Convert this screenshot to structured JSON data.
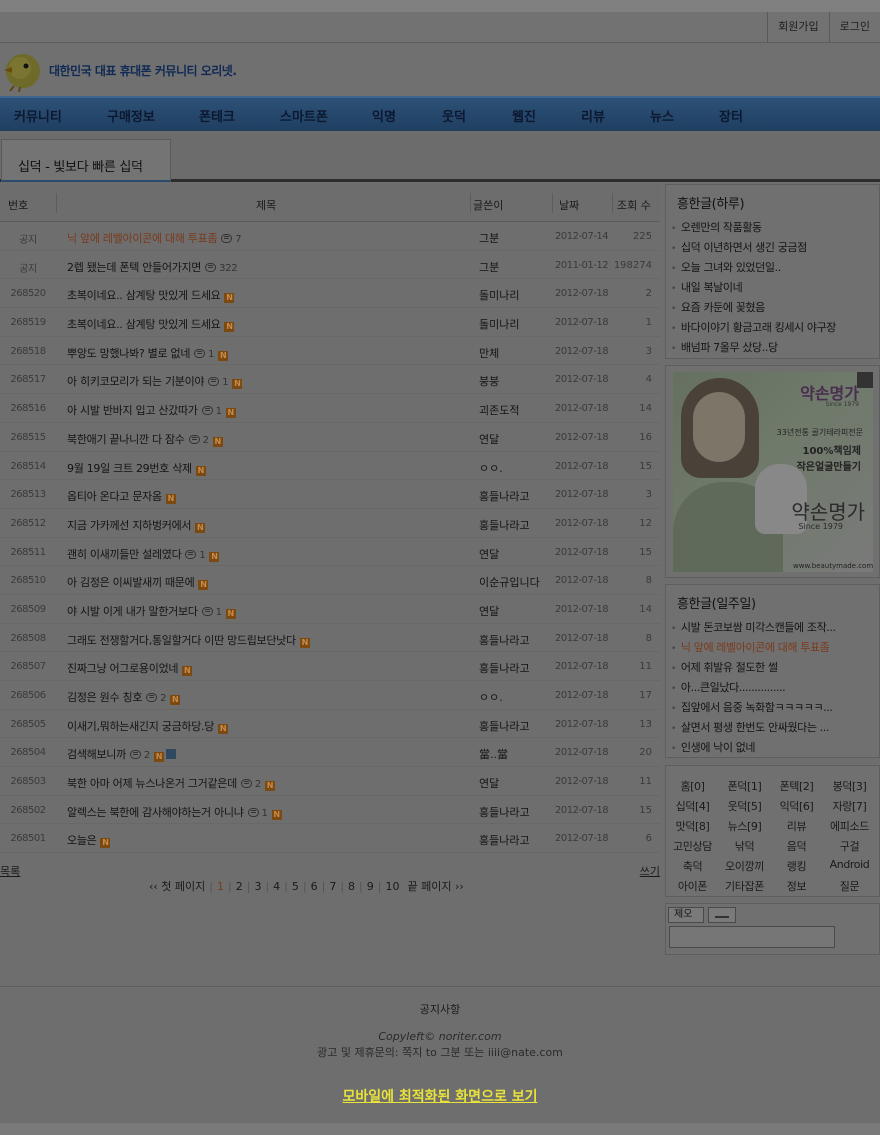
{
  "top_links": [
    "회원가입",
    "로그인"
  ],
  "header": {
    "slogan": "대한민국 대표 휴대폰 커뮤니티 오리넷."
  },
  "nav": [
    "커뮤니티",
    "구매정보",
    "폰테크",
    "스마트폰",
    "익명",
    "웃덕",
    "웹진",
    "리뷰",
    "뉴스",
    "장터"
  ],
  "board": {
    "tab_title": "십덕 - 빛보다 빠른 십덕",
    "columns": [
      "번호",
      "제목",
      "글쓴이",
      "날짜",
      "조회 수"
    ],
    "rows": [
      {
        "no": "공지",
        "subject": "닉 앞에 레벨아이콘에 대해 투표좀",
        "comments": "7",
        "new": false,
        "writer": "그분",
        "date": "2012-07-14",
        "views": "225",
        "hl": true
      },
      {
        "no": "공지",
        "subject": "2렙 됐는데 폰텍 안들어가지면",
        "comments": "322",
        "new": false,
        "writer": "그분",
        "date": "2011-01-12",
        "views": "198274",
        "hl": false
      },
      {
        "no": "268520",
        "subject": "초복이네요.. 삼계탕 맛있게 드세요",
        "comments": "",
        "new": true,
        "writer": "돌미나리",
        "date": "2012-07-18",
        "views": "2",
        "hl": false
      },
      {
        "no": "268519",
        "subject": "초복이네요.. 삼계탕 맛있게 드세요",
        "comments": "",
        "new": true,
        "writer": "돌미나리",
        "date": "2012-07-18",
        "views": "1",
        "hl": false
      },
      {
        "no": "268518",
        "subject": "뿌앙도 망했나봐? 별로 없네",
        "comments": "1",
        "new": true,
        "writer": "만체",
        "date": "2012-07-18",
        "views": "3",
        "hl": false
      },
      {
        "no": "268517",
        "subject": "아 히키코모리가 되는 기분이야",
        "comments": "1",
        "new": true,
        "writer": "붕붕",
        "date": "2012-07-18",
        "views": "4",
        "hl": false
      },
      {
        "no": "268516",
        "subject": "아 시발 반바지 입고 산갔따가",
        "comments": "1",
        "new": true,
        "writer": "괴존도적",
        "date": "2012-07-18",
        "views": "14",
        "hl": false
      },
      {
        "no": "268515",
        "subject": "북한애기 끝나니깐 다 잠수",
        "comments": "2",
        "new": true,
        "writer": "연달",
        "date": "2012-07-18",
        "views": "16",
        "hl": false
      },
      {
        "no": "268514",
        "subject": "9월 19일 크트 29번호 삭제",
        "comments": "",
        "new": true,
        "writer": "ㅇㅇ.",
        "date": "2012-07-18",
        "views": "15",
        "hl": false
      },
      {
        "no": "268513",
        "subject": "옵티아 온다고 문자옴",
        "comments": "",
        "new": true,
        "writer": "홍들나라고",
        "date": "2012-07-18",
        "views": "3",
        "hl": false
      },
      {
        "no": "268512",
        "subject": "지금 가카께선 지하벙커에서",
        "comments": "",
        "new": true,
        "writer": "홍들나라고",
        "date": "2012-07-18",
        "views": "12",
        "hl": false
      },
      {
        "no": "268511",
        "subject": "괜히 이새끼들만 설레였다",
        "comments": "1",
        "new": true,
        "writer": "연달",
        "date": "2012-07-18",
        "views": "15",
        "hl": false
      },
      {
        "no": "268510",
        "subject": "아 김정은 이씨발새끼 때문에",
        "comments": "",
        "new": true,
        "writer": "이순규입니다",
        "date": "2012-07-18",
        "views": "8",
        "hl": false
      },
      {
        "no": "268509",
        "subject": "야 시발 이게 내가 말한거보다",
        "comments": "1",
        "new": true,
        "writer": "연달",
        "date": "2012-07-18",
        "views": "14",
        "hl": false
      },
      {
        "no": "268508",
        "subject": "그래도 전쟁할거다,통일할거다 이딴 망드립보단낫다",
        "comments": "",
        "new": true,
        "writer": "홍들나라고",
        "date": "2012-07-18",
        "views": "8",
        "hl": false
      },
      {
        "no": "268507",
        "subject": "진짜그냥 어그로용이었네",
        "comments": "",
        "new": true,
        "writer": "홍들나라고",
        "date": "2012-07-18",
        "views": "11",
        "hl": false
      },
      {
        "no": "268506",
        "subject": "김정은 원수 칭호",
        "comments": "2",
        "new": true,
        "writer": "ㅇㅇ.",
        "date": "2012-07-18",
        "views": "17",
        "hl": false
      },
      {
        "no": "268505",
        "subject": "이새기,뭐하는새긴지 궁금하당.당",
        "comments": "",
        "new": true,
        "writer": "홍들나라고",
        "date": "2012-07-18",
        "views": "13",
        "hl": false
      },
      {
        "no": "268504",
        "subject": "검색해보니까",
        "comments": "2",
        "new": true,
        "file": true,
        "writer": "當..當",
        "date": "2012-07-18",
        "views": "20",
        "hl": false
      },
      {
        "no": "268503",
        "subject": "북한 아마 어제 뉴스나온거 그거같은데",
        "comments": "2",
        "new": true,
        "writer": "연달",
        "date": "2012-07-18",
        "views": "11",
        "hl": false
      },
      {
        "no": "268502",
        "subject": "알렉스는 북한에 감사해야하는거 아니냐",
        "comments": "1",
        "new": true,
        "writer": "홍들나라고",
        "date": "2012-07-18",
        "views": "15",
        "hl": false
      },
      {
        "no": "268501",
        "subject": "오늘은",
        "comments": "",
        "new": true,
        "writer": "홍들나라고",
        "date": "2012-07-18",
        "views": "6",
        "hl": false
      }
    ],
    "list_label": "목록",
    "write_label": "쓰기",
    "pager": {
      "first": "‹‹ 첫 페이지",
      "pages": [
        "1",
        "2",
        "3",
        "4",
        "5",
        "6",
        "7",
        "8",
        "9",
        "10"
      ],
      "current": "1",
      "last": "끝 페이지 ››"
    }
  },
  "side": {
    "daily": {
      "title": "흥한글(하루)",
      "items": [
        "오렌만의 작품활동",
        "십덕 이년하면서 생긴 궁금점",
        "오늘 그녀와 있었던일..",
        "내일 복날이네",
        "요즘 카둔에 꽂혔음",
        "바다이야기 황금고래 킹세시 야구장",
        "배넘파 7올무 샀당..당"
      ]
    },
    "ad": {
      "brand": "약손명가",
      "since": "Since 1979",
      "line1": "33년전통 골기테라피전문",
      "line2": "100%책임제",
      "line3": "작은얼굴만들기",
      "big": "약손명가",
      "since2": "Since 1979",
      "url": "www.beautymade.com"
    },
    "weekly": {
      "title": "흥한글(일주일)",
      "items": [
        "시발 돈코보쌈 미각스캔들에 조작...",
        "닉 앞에 레벨아이콘에 대해 투표좀",
        "어제 휘발유 절도한 썰",
        "아...큰일났다...............",
        "집앞에서 음중 녹화함ㅋㅋㅋㅋㅋ...",
        "살면서 평생 한번도 안싸웠다는 ...",
        "인생에 낙이 없네"
      ],
      "highlight_index": 1
    },
    "categories": [
      "홈[0]",
      "폰덕[1]",
      "폰텍[2]",
      "봉덕[3]",
      "십덕[4]",
      "웃덕[5]",
      "익덕[6]",
      "자랑[7]",
      "맛덕[8]",
      "뉴스[9]",
      "리뷰",
      "에피소드",
      "고민상담",
      "낚덕",
      "음덕",
      "구걸",
      "축덕",
      "오이깡끼",
      "랭킹",
      "Android",
      "아이폰",
      "기타잡폰",
      "정보",
      "질문"
    ],
    "memo_label": "제오"
  },
  "footer": {
    "notice": "공지사항",
    "copyright": "Copyleft© noriter.com",
    "ad_contact": "광고 및 제휴문의: 쪽지 to 그분 또는 iiii@nate.com",
    "mobile_link": "모바일에 최적화된 화면으로 보기"
  },
  "colors": {
    "nav": "#24476c",
    "highlight": "#7a3a1c",
    "mobile_link": "#e8e23a"
  }
}
